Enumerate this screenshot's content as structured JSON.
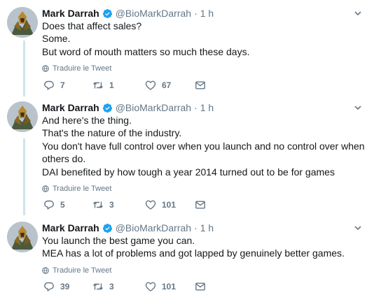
{
  "tweets": [
    {
      "author": "Mark Darrah",
      "handle": "@BioMarkDarrah",
      "separator": "·",
      "time": "1 h",
      "lines": [
        "Does that affect sales?",
        "Some.",
        "But word of mouth matters so much these days."
      ],
      "translate_label": "Traduire le Tweet",
      "replies": "7",
      "retweets": "1",
      "likes": "67"
    },
    {
      "author": "Mark Darrah",
      "handle": "@BioMarkDarrah",
      "separator": "·",
      "time": "1 h",
      "lines": [
        "And here's the thing.",
        "That's the nature of the industry.",
        "You don't have full control over when you launch and no control over when",
        "others do.",
        "DAI benefited by how tough a year 2014 turned out to be for games"
      ],
      "translate_label": "Traduire le Tweet",
      "replies": "5",
      "retweets": "3",
      "likes": "101"
    },
    {
      "author": "Mark Darrah",
      "handle": "@BioMarkDarrah",
      "separator": "·",
      "time": "1 h",
      "lines": [
        "You launch the best game you can.",
        "MEA has a lot of problems and got lapped by genuinely better games."
      ],
      "translate_label": "Traduire le Tweet",
      "replies": "39",
      "retweets": "3",
      "likes": "101"
    }
  ],
  "colors": {
    "text": "#14171a",
    "secondary": "#657786",
    "verified": "#1da1f2",
    "thread_line": "#cfe3f0"
  },
  "icons": [
    "verified-badge-icon",
    "caret-down-icon",
    "globe-icon",
    "reply-icon",
    "retweet-icon",
    "like-icon",
    "message-icon"
  ]
}
